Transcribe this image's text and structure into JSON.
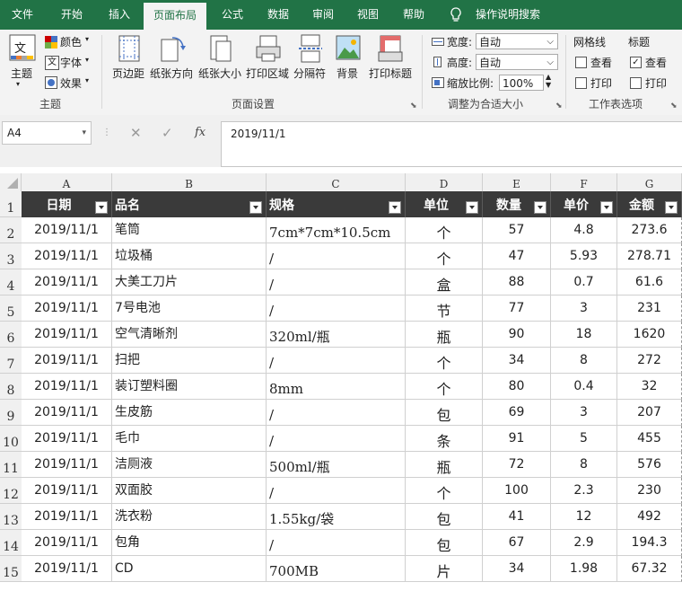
{
  "tabs": [
    "文件",
    "开始",
    "插入",
    "页面布局",
    "公式",
    "数据",
    "审阅",
    "视图",
    "帮助"
  ],
  "active_tab": "页面布局",
  "tell_me": "操作说明搜索",
  "ribbon": {
    "theme": {
      "main": "主题",
      "colors": "颜色",
      "fonts": "字体",
      "effects": "效果",
      "group": "主题"
    },
    "page_setup": {
      "margins": "页边距",
      "orientation": "纸张方向",
      "size": "纸张大小",
      "print_area": "打印区域",
      "breaks": "分隔符",
      "background": "背景",
      "print_titles": "打印标题",
      "group": "页面设置"
    },
    "scale": {
      "width_label": "宽度:",
      "width_value": "自动",
      "height_label": "高度:",
      "height_value": "自动",
      "scale_label": "缩放比例:",
      "scale_value": "100%",
      "group": "调整为合适大小"
    },
    "sheet_options": {
      "gridlines": "网格线",
      "headings": "标题",
      "view": "查看",
      "print": "打印",
      "group": "工作表选项"
    }
  },
  "formula_bar": {
    "name_box": "A4",
    "formula": "2019/11/1"
  },
  "columns": [
    "A",
    "B",
    "C",
    "D",
    "E",
    "F",
    "G"
  ],
  "headers": [
    "日期",
    "品名",
    "规格",
    "单位",
    "数量",
    "单价",
    "金额"
  ],
  "rows": [
    [
      "2019/11/1",
      "笔筒",
      "7cm*7cm*10.5cm",
      "个",
      "57",
      "4.8",
      "273.6"
    ],
    [
      "2019/11/1",
      "垃圾桶",
      "/",
      "个",
      "47",
      "5.93",
      "278.71"
    ],
    [
      "2019/11/1",
      "大美工刀片",
      "/",
      "盒",
      "88",
      "0.7",
      "61.6"
    ],
    [
      "2019/11/1",
      "7号电池",
      "/",
      "节",
      "77",
      "3",
      "231"
    ],
    [
      "2019/11/1",
      "空气清晰剂",
      "320ml/瓶",
      "瓶",
      "90",
      "18",
      "1620"
    ],
    [
      "2019/11/1",
      "扫把",
      "/",
      "个",
      "34",
      "8",
      "272"
    ],
    [
      "2019/11/1",
      "装订塑料圈",
      "8mm",
      "个",
      "80",
      "0.4",
      "32"
    ],
    [
      "2019/11/1",
      "生皮筋",
      "/",
      "包",
      "69",
      "3",
      "207"
    ],
    [
      "2019/11/1",
      "毛巾",
      "/",
      "条",
      "91",
      "5",
      "455"
    ],
    [
      "2019/11/1",
      "洁厕液",
      "500ml/瓶",
      "瓶",
      "72",
      "8",
      "576"
    ],
    [
      "2019/11/1",
      "双面胶",
      "/",
      "个",
      "100",
      "2.3",
      "230"
    ],
    [
      "2019/11/1",
      "洗衣粉",
      "1.55kg/袋",
      "包",
      "41",
      "12",
      "492"
    ],
    [
      "2019/11/1",
      "包角",
      "/",
      "包",
      "67",
      "2.9",
      "194.3"
    ],
    [
      "2019/11/1",
      "CD",
      "700MB",
      "片",
      "34",
      "1.98",
      "67.32"
    ]
  ],
  "row_numbers": [
    "1",
    "2",
    "3",
    "4",
    "5",
    "6",
    "7",
    "8",
    "9",
    "10",
    "11",
    "12",
    "13",
    "14",
    "15"
  ],
  "colors": {
    "excel_green": "#217346",
    "header_fill": "#3a3a3a"
  }
}
